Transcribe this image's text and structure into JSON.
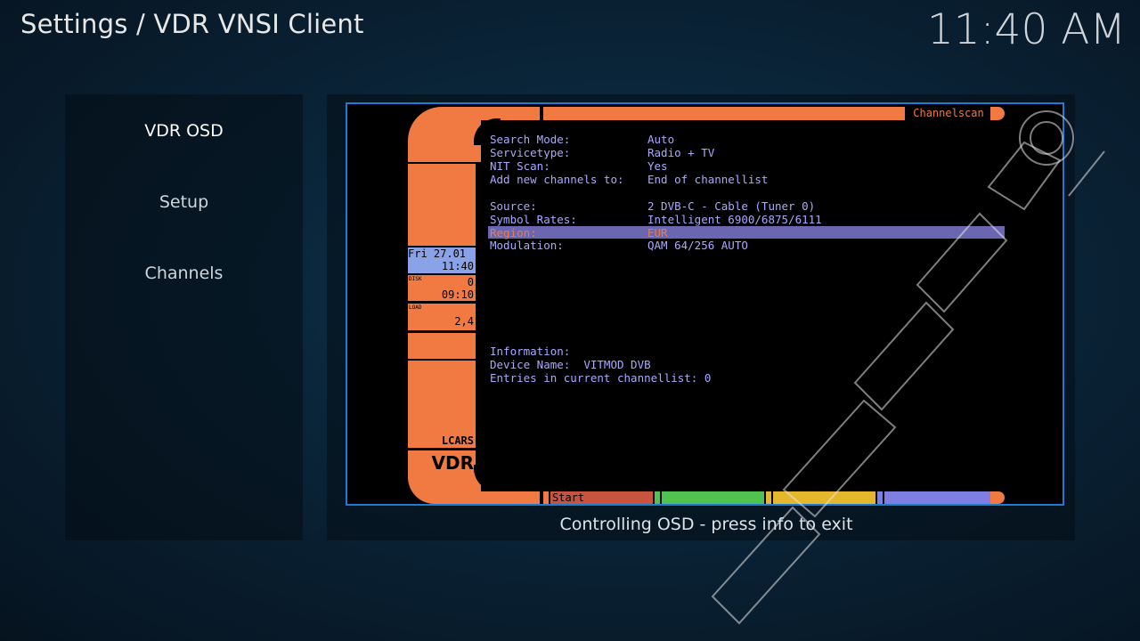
{
  "header": {
    "title": "Settings / VDR VNSI Client",
    "clock": "11:40 AM"
  },
  "sidebar": {
    "items": [
      {
        "label": "VDR OSD",
        "active": true
      },
      {
        "label": "Setup",
        "active": false
      },
      {
        "label": "Channels",
        "active": false
      }
    ]
  },
  "osd": {
    "hint": "Controlling OSD - press info to exit",
    "title": "Channelscan",
    "side": {
      "date": "Fri 27.01",
      "time": "11:40",
      "disk_label": "DISK",
      "disk_value": "0",
      "disk_time": "09:10",
      "load_label": "LOAD",
      "load_value": "2,4",
      "lcars": "LCARS",
      "vdr": "VDR"
    },
    "rows": [
      {
        "label": "Search Mode:",
        "value": "Auto"
      },
      {
        "label": "Servicetype:",
        "value": "Radio + TV"
      },
      {
        "label": "NIT Scan:",
        "value": "Yes"
      },
      {
        "label": "Add new channels to:",
        "value": "End of channellist"
      },
      {
        "label": "Source:",
        "value": "2 DVB-C - Cable (Tuner 0)"
      },
      {
        "label": "Symbol Rates:",
        "value": "Intelligent 6900/6875/6111"
      },
      {
        "label": "Region:",
        "value": "EUR"
      },
      {
        "label": "Modulation:",
        "value": "QAM 64/256 AUTO"
      }
    ],
    "info": {
      "heading": "Information:",
      "device": "Device Name:  VITMOD DVB",
      "entries": "Entries in current channellist: 0"
    },
    "buttons": {
      "red": "Start",
      "green": "",
      "yellow": "",
      "blue": ""
    }
  },
  "colors": {
    "lcars_orange": "#f07a42",
    "frame_blue": "#1f7bd0",
    "menu_text": "#a9a9ff",
    "selection": "#6a67b0"
  }
}
